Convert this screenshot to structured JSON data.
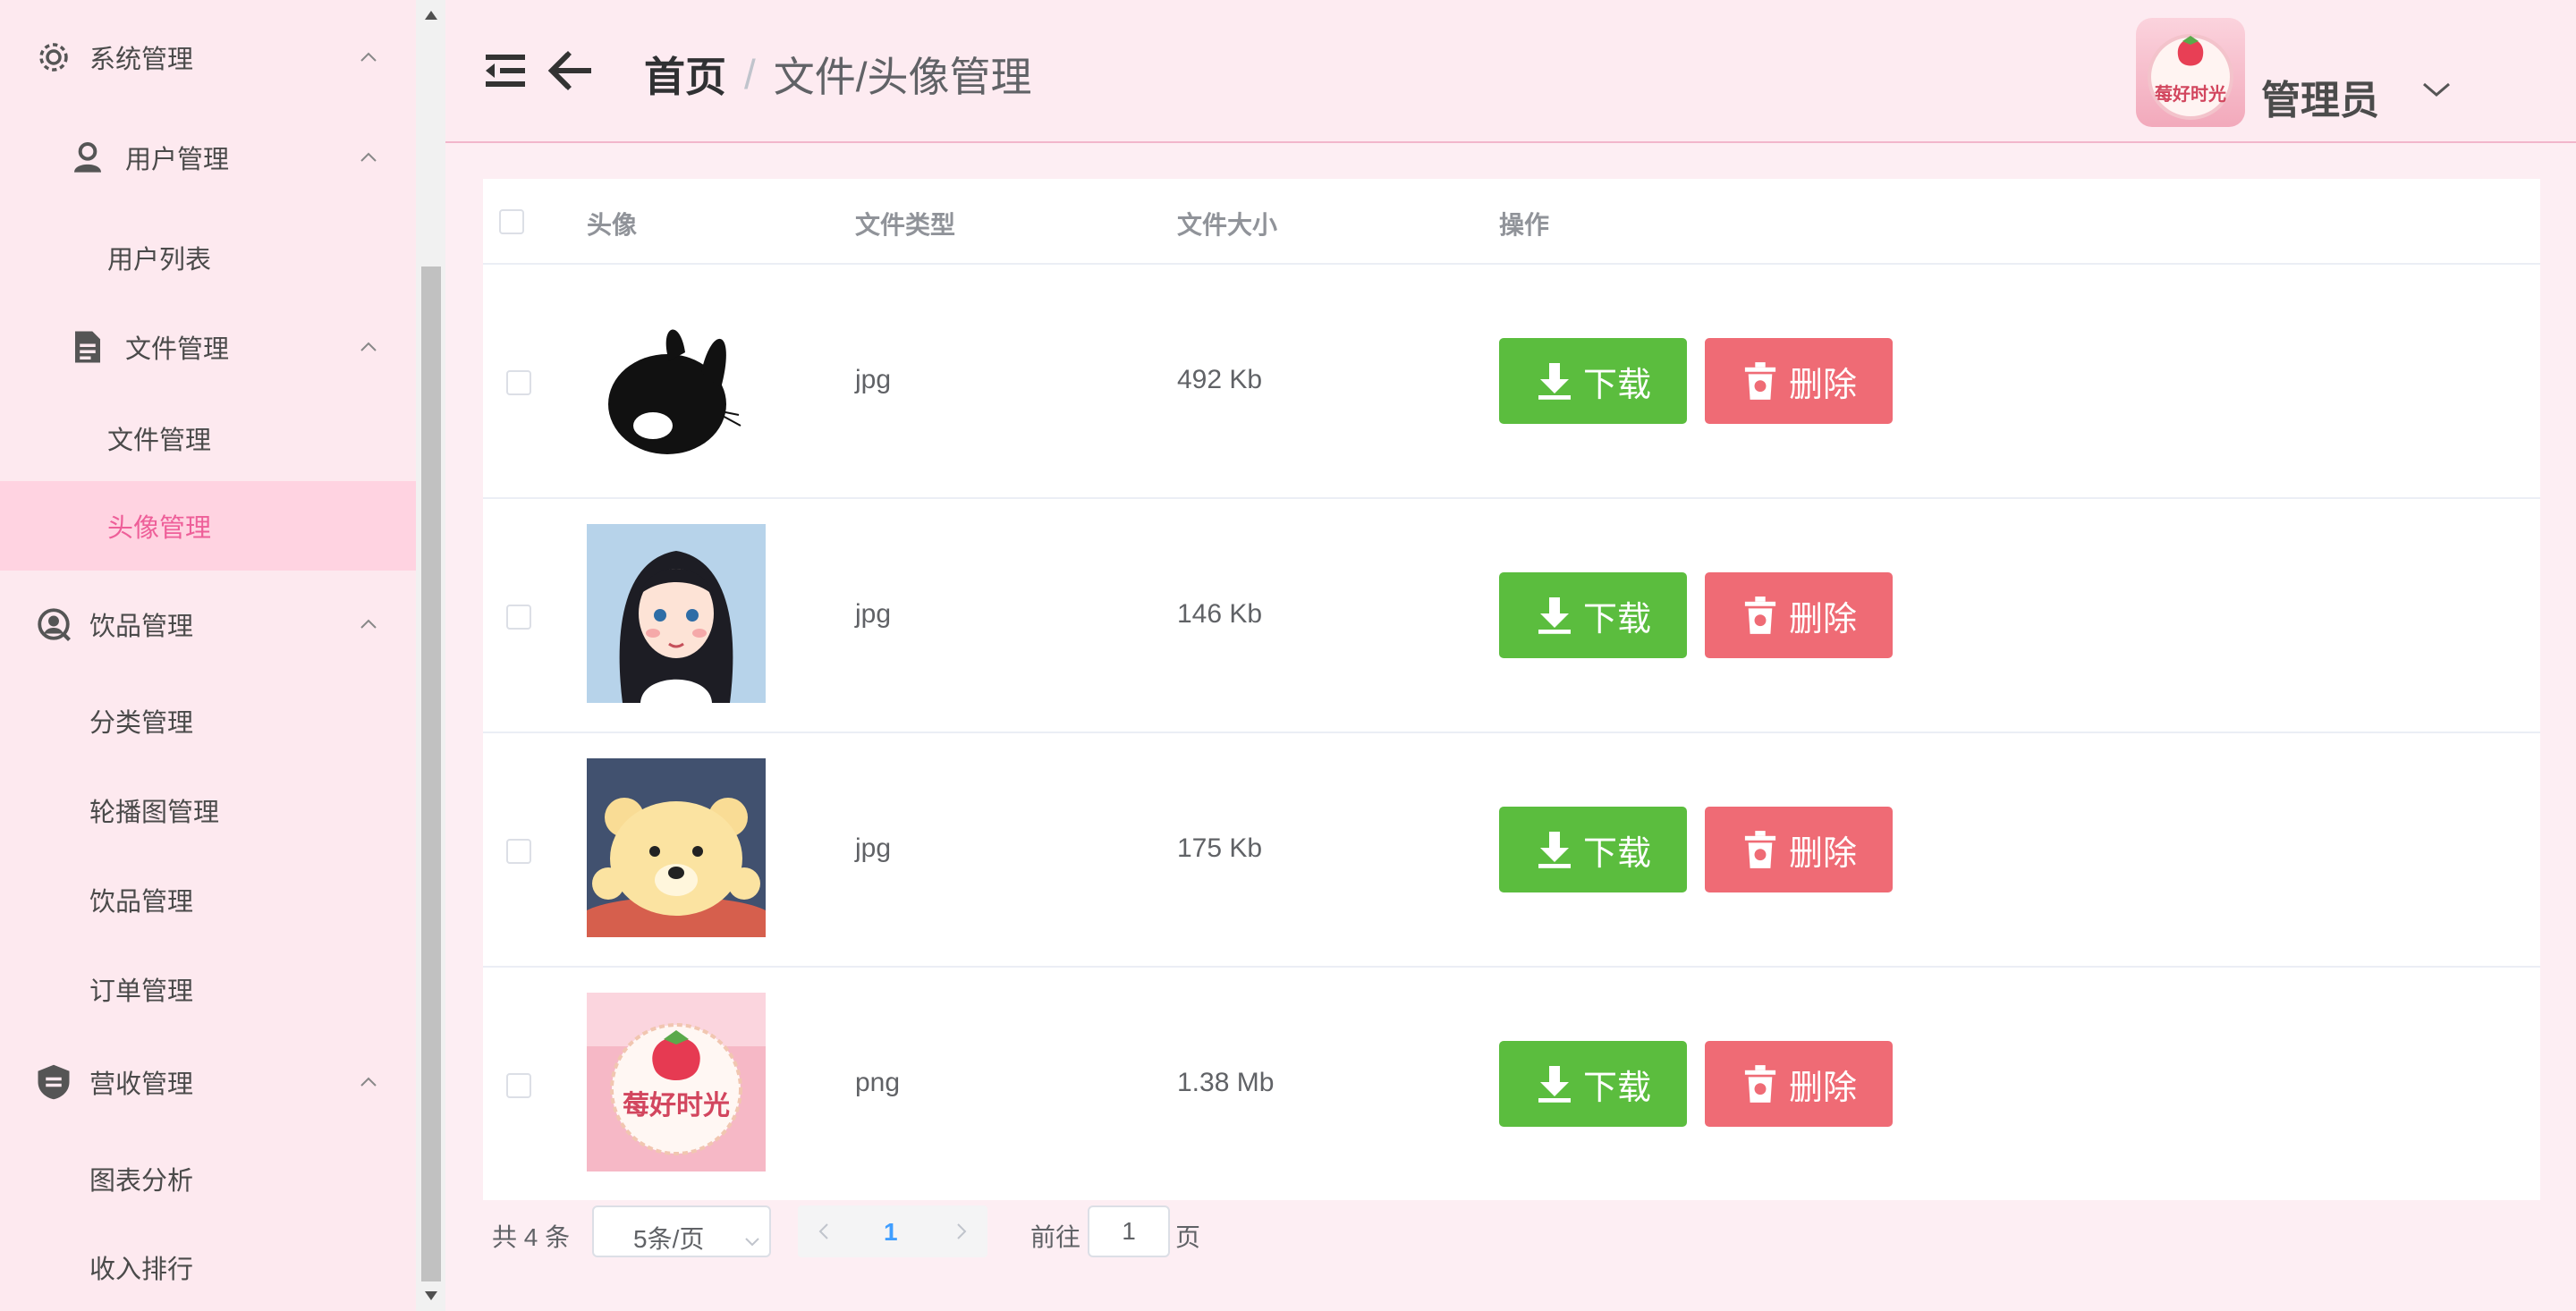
{
  "sidebar": {
    "items": [
      {
        "label": "系统管理",
        "icon": "gear-icon",
        "level": 1
      },
      {
        "label": "用户管理",
        "icon": "user-icon",
        "level": 2
      },
      {
        "label": "用户列表",
        "level": 3
      },
      {
        "label": "文件管理",
        "icon": "document-icon",
        "level": 2
      },
      {
        "label": "文件管理",
        "level": 3
      },
      {
        "label": "头像管理",
        "level": 3,
        "active": true
      },
      {
        "label": "饮品管理",
        "icon": "search-user-icon",
        "level": 1
      },
      {
        "label": "分类管理",
        "level": 2
      },
      {
        "label": "轮播图管理",
        "level": 2
      },
      {
        "label": "饮品管理",
        "level": 2
      },
      {
        "label": "订单管理",
        "level": 2
      },
      {
        "label": "营收管理",
        "icon": "shield-icon",
        "level": 1
      },
      {
        "label": "图表分析",
        "level": 2
      },
      {
        "label": "收入排行",
        "level": 2
      }
    ]
  },
  "header": {
    "breadcrumb_home": "首页",
    "breadcrumb_sep": "/",
    "breadcrumb_current": "文件/头像管理",
    "username": "管理员",
    "avatar_text": "莓好时光"
  },
  "table": {
    "columns": [
      "头像",
      "文件类型",
      "文件大小",
      "操作"
    ],
    "rows": [
      {
        "avatar": "rabbit-silhouette",
        "type": "jpg",
        "size": "492 Kb"
      },
      {
        "avatar": "girl-portrait",
        "type": "jpg",
        "size": "146 Kb"
      },
      {
        "avatar": "teddy-bear",
        "type": "jpg",
        "size": "175 Kb"
      },
      {
        "avatar": "strawberry-logo",
        "type": "png",
        "size": "1.38 Mb"
      }
    ],
    "download_label": "下载",
    "delete_label": "删除"
  },
  "pagination": {
    "total": "共 4 条",
    "page_size": "5条/页",
    "current_page": "1",
    "goto_prefix": "前往",
    "goto_value": "1",
    "goto_suffix": "页"
  },
  "colors": {
    "accent": "#ee5f99",
    "download": "#5bbd3e",
    "delete": "#ef6b75",
    "sidebar_bg": "#fde9ef",
    "active_bg": "#ffd3e1"
  }
}
